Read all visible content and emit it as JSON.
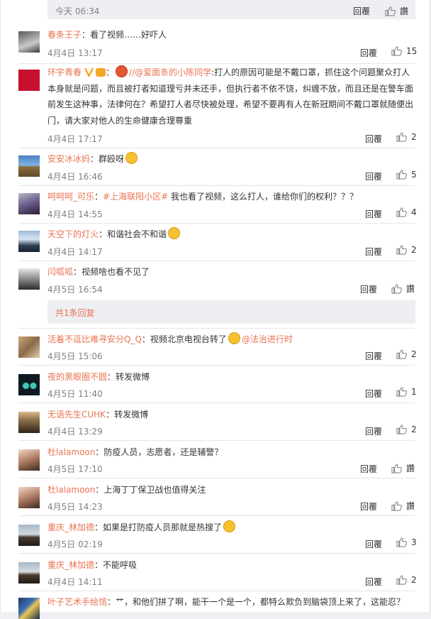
{
  "top": {
    "time": "今天 06:34",
    "reply": "回覆",
    "like": "讚"
  },
  "expander": "共1条回复",
  "comments": [
    {
      "name": "春条王子",
      "text": "：看了视频……好吓人",
      "time": "4月4日 13:17",
      "reply": "回覆",
      "likes": "15"
    },
    {
      "name": "环宇青春",
      "text_before": "：",
      "mention": "//@爱面条的小陈同学",
      "text": ":打人的原因可能是不戴口罩，抓住这个问题聚众打人本身就是问题，而且被打者知道理亏并未还手，但执行者不依不饶，纠缠不放，而且还是在警车面前发生这种事，法律何在？希望打人者尽快被处理，希望不要再有人在新冠期间不戴口罩就随便出门，请大家对他人的生命健康合理尊重",
      "time": "4月4日 17:17",
      "reply": "回覆",
      "likes": "2"
    },
    {
      "name": "安安冰冰妈",
      "text": "：群殴呀",
      "time": "4月4日 16:46",
      "reply": "回覆",
      "likes": "5"
    },
    {
      "name": "呵呵呵_可乐",
      "topic": "#上海联阳小区#",
      "text": " 我也看了视频，这么打人，谁给你们的权利？？？",
      "time": "4月4日 14:55",
      "reply": "回覆",
      "likes": "4"
    },
    {
      "name": "天空下的灯火",
      "text": "：和谐社会不和谐",
      "time": "4月4日 14:17",
      "reply": "回覆",
      "likes": "2"
    },
    {
      "name": "闫呱呱",
      "text": "：视频啥也看不见了",
      "time": "4月5日 16:54",
      "reply": "回覆",
      "likes": "讚"
    },
    {
      "name": "活着不逗比难寻安分Q_Q",
      "text": "：视频北京电视台转了",
      "mention": "@法治进行时",
      "time": "4月5日 15:06",
      "reply": "回覆",
      "likes": "2"
    },
    {
      "name": "夜的黑眼圈不圆",
      "text": "：转发微博",
      "time": "4月5日 11:40",
      "reply": "回覆",
      "likes": "1"
    },
    {
      "name": "无语先生CUHK",
      "text": "：转发微博",
      "time": "4月4日 13:29",
      "reply": "回覆",
      "likes": "2"
    },
    {
      "name": "杜lalamoon",
      "text": "：防疫人员，志愿者，还是辅警？",
      "time": "4月5日 17:10",
      "reply": "回覆",
      "likes": "讚"
    },
    {
      "name": "杜lalamoon",
      "text": "：上海丁丁保卫战也值得关注",
      "time": "4月5日 14:23",
      "reply": "回覆",
      "likes": "讚"
    },
    {
      "name": "重庆_林加德",
      "text": "：如果是打防疫人员那就是热搜了",
      "time": "4月5日 02:19",
      "reply": "回覆",
      "likes": "3"
    },
    {
      "name": "重庆_林加德",
      "text": "：不能呼吸",
      "time": "4月4日 14:11",
      "reply": "回覆",
      "likes": "2"
    },
    {
      "name": "叶子艺术手绘馆",
      "text": "：艹，和他们拼了啊，能干一个是一个，都特么欺负到脑袋顶上来了，这能忍？"
    }
  ],
  "colors": {
    "accent": "#eb7350",
    "meta": "#808080",
    "panel": "#eeeff3"
  }
}
